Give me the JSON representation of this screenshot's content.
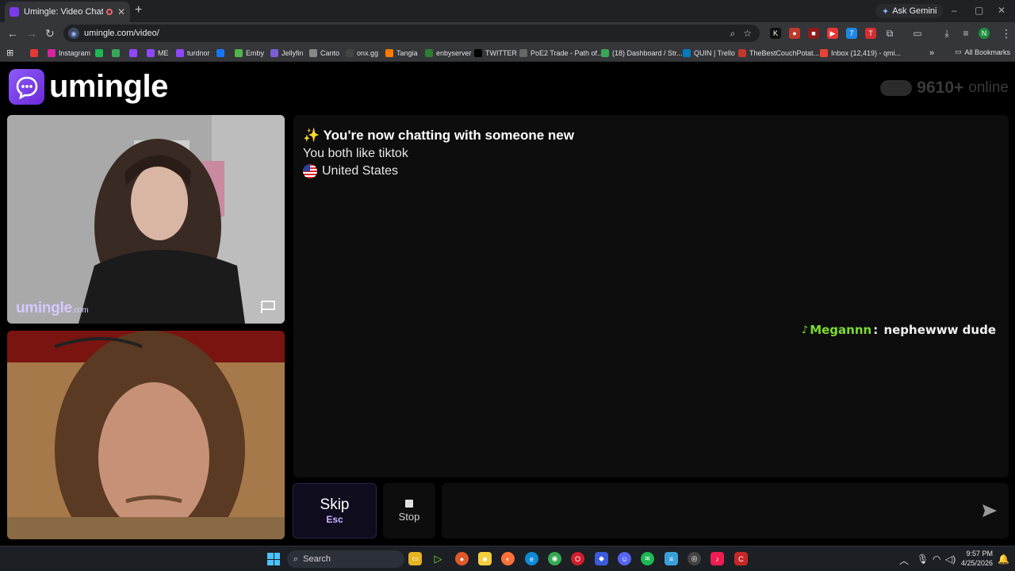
{
  "browser": {
    "tab_title": "Umingle: Video Chat with S",
    "tab_close": "✕",
    "new_tab": "+",
    "ask_gemini": "Ask Gemini",
    "url": "umingle.com/video/",
    "all_bookmarks": "All Bookmarks",
    "profile_initial": "N",
    "bookmarks": [
      {
        "label": "",
        "color": "#e53935"
      },
      {
        "label": "Instagram",
        "color": "#d6249f"
      },
      {
        "label": "",
        "color": "#1db954"
      },
      {
        "label": "",
        "color": "#3aa757"
      },
      {
        "label": "",
        "color": "#9146ff"
      },
      {
        "label": "ME",
        "color": "#9146ff"
      },
      {
        "label": "turdnor",
        "color": "#9146ff"
      },
      {
        "label": "",
        "color": "#1877f2"
      },
      {
        "label": "Emby",
        "color": "#52b54b"
      },
      {
        "label": "Jellyfin",
        "color": "#7b5cd6"
      },
      {
        "label": "Canto",
        "color": "#888888"
      },
      {
        "label": "onx.gg",
        "color": "#444444"
      },
      {
        "label": "Tangia",
        "color": "#ff7a00"
      },
      {
        "label": "enbyserver",
        "color": "#2e7d32"
      },
      {
        "label": "TWITTER",
        "color": "#000000"
      },
      {
        "label": "PoE2 Trade - Path of...",
        "color": "#666666"
      },
      {
        "label": "(18) Dashboard / Str...",
        "color": "#3aa757"
      },
      {
        "label": "QUIN | Trello",
        "color": "#0079bf"
      },
      {
        "label": "TheBestCouchPotat...",
        "color": "#c0392b"
      },
      {
        "label": "Inbox (12,419) - qmi...",
        "color": "#ea4335"
      }
    ]
  },
  "site": {
    "logo_text": "umingle",
    "online_count": "9610+",
    "online_label": "online",
    "watermark_main": "umingle",
    "watermark_suffix": ".com"
  },
  "chat": {
    "sparkle": "✨",
    "headline": "You're now chatting with someone new",
    "common_interest": "You both like tiktok",
    "country": "United States",
    "messages": [
      {
        "icon": "♪",
        "author": "Megannn",
        "separator": ": ",
        "text": "nephewww dude"
      }
    ],
    "input_value": "",
    "input_placeholder": ""
  },
  "controls": {
    "skip_label": "Skip",
    "skip_key": "Esc",
    "stop_label": "Stop"
  },
  "taskbar": {
    "search_label": "Search",
    "time": "9:57 PM",
    "date": "4/25/2026"
  },
  "colors": {
    "accent": "#7c3aed",
    "message_author": "#7cdb2f",
    "skip_key": "#c9b6ff"
  }
}
